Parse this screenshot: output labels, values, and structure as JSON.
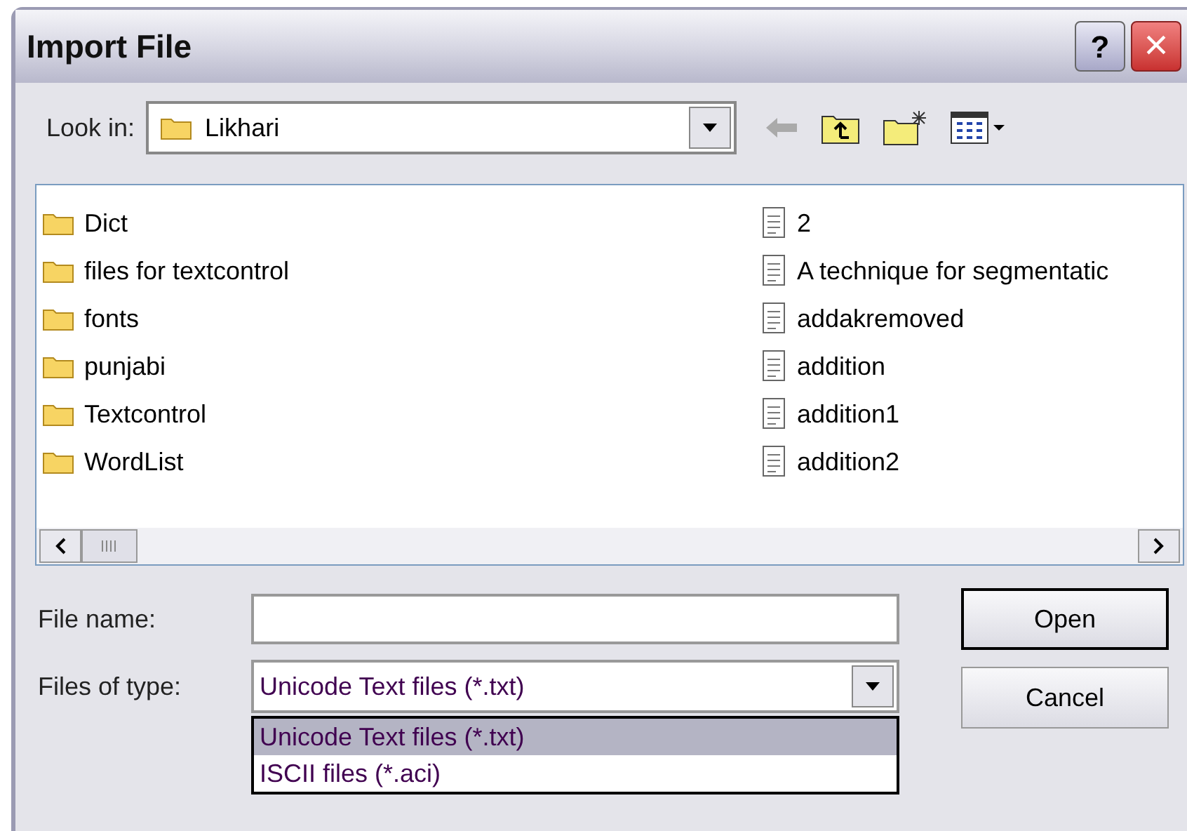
{
  "window": {
    "title": "Import File",
    "help_button": "?",
    "close_button": "×"
  },
  "look_in": {
    "label": "Look in:",
    "value": "Likhari"
  },
  "files": [
    {
      "name": "Dict",
      "kind": "folder"
    },
    {
      "name": "files for textcontrol",
      "kind": "folder"
    },
    {
      "name": "fonts",
      "kind": "folder"
    },
    {
      "name": "punjabi",
      "kind": "folder"
    },
    {
      "name": "Textcontrol",
      "kind": "folder"
    },
    {
      "name": "WordList",
      "kind": "folder"
    },
    {
      "name": "2",
      "kind": "file"
    },
    {
      "name": "A technique for segmentatic",
      "kind": "file"
    },
    {
      "name": "addakremoved",
      "kind": "file"
    },
    {
      "name": "addition",
      "kind": "file"
    },
    {
      "name": "addition1",
      "kind": "file"
    },
    {
      "name": "addition2",
      "kind": "file"
    }
  ],
  "file_name": {
    "label": "File name:"
  },
  "files_of_type": {
    "label": "Files of type:",
    "value": "Unicode Text files (*.txt)",
    "options": [
      {
        "label": "Unicode Text files (*.txt)",
        "selected": true
      },
      {
        "label": "ISCII files (*.aci)",
        "selected": false
      }
    ]
  },
  "buttons": [
    "Open",
    "Cancel"
  ]
}
